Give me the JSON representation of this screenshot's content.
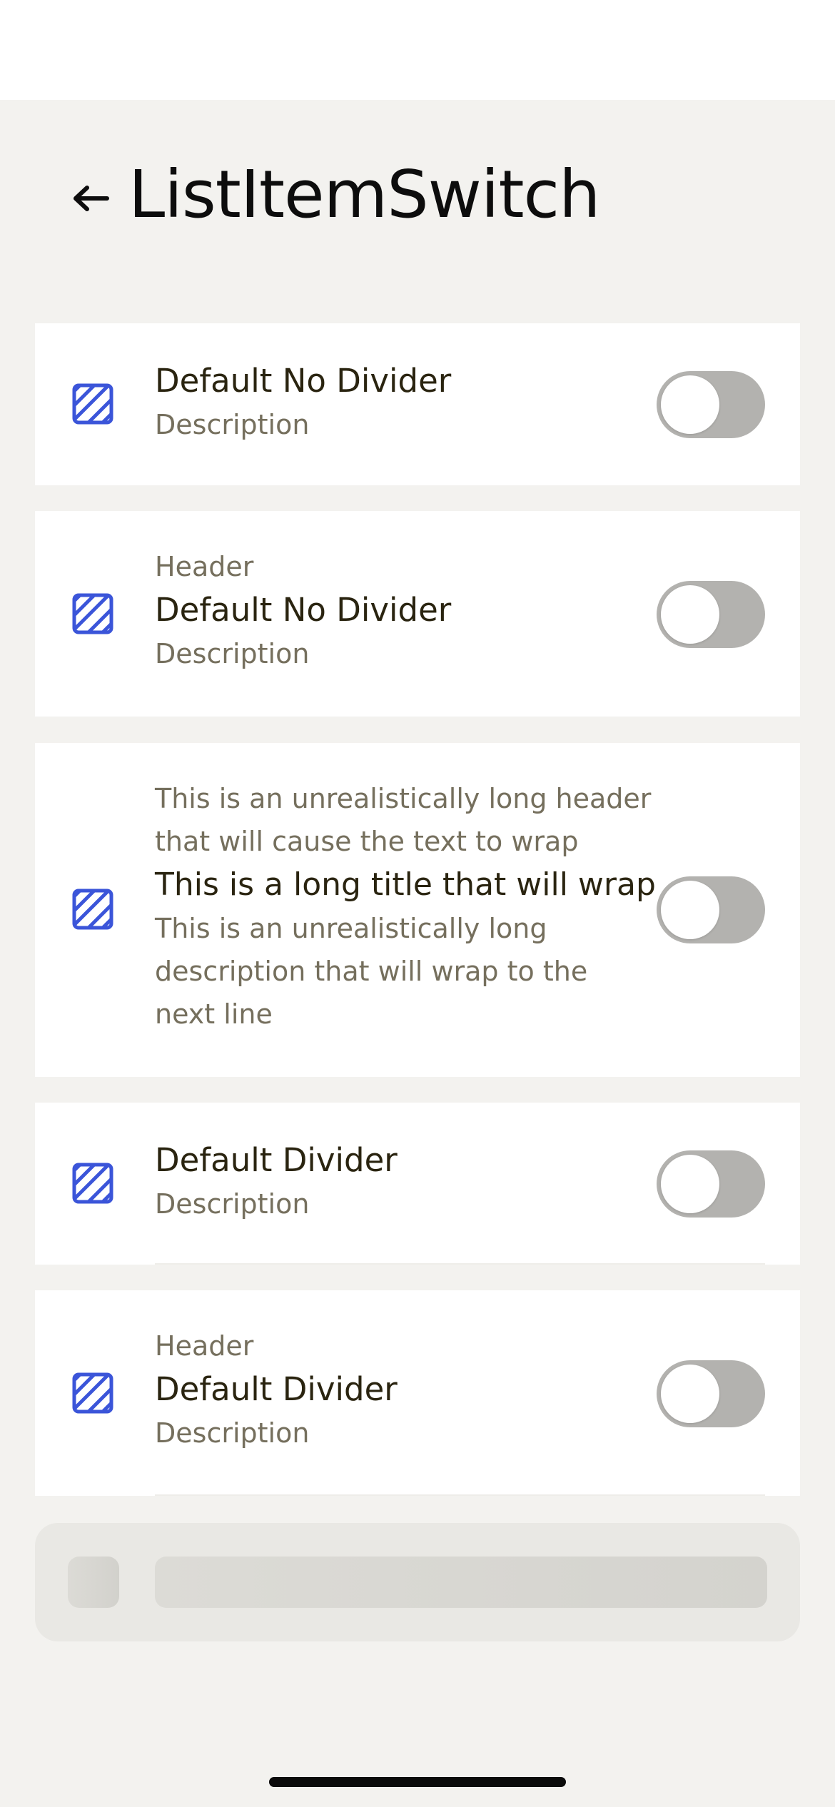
{
  "page": {
    "title": "ListItemSwitch",
    "back_icon": "arrow-left-icon"
  },
  "items": [
    {
      "header": "",
      "title": "Default No Divider",
      "description": "Description",
      "icon": "striped-square-icon",
      "switch_on": false,
      "divider": false
    },
    {
      "header": "Header",
      "title": "Default No Divider",
      "description": "Description",
      "icon": "striped-square-icon",
      "switch_on": false,
      "divider": false
    },
    {
      "header": "This is an unrealistically long header that will cause the text to wrap",
      "title": "This is a long title that will wrap",
      "description": "This is an unrealistically long description that will wrap to the next line",
      "icon": "striped-square-icon",
      "switch_on": false,
      "divider": false
    },
    {
      "header": "",
      "title": "Default Divider",
      "description": "Description",
      "icon": "striped-square-icon",
      "switch_on": false,
      "divider": true
    },
    {
      "header": "Header",
      "title": "Default Divider",
      "description": "Description",
      "icon": "striped-square-icon",
      "switch_on": false,
      "divider": true
    }
  ],
  "colors": {
    "background": "#f3f2ef",
    "card": "#ffffff",
    "icon_accent": "#3b55d9",
    "switch_track_off": "#b3b2af",
    "title_text": "#2a2410",
    "secondary_text": "#756f5d"
  }
}
